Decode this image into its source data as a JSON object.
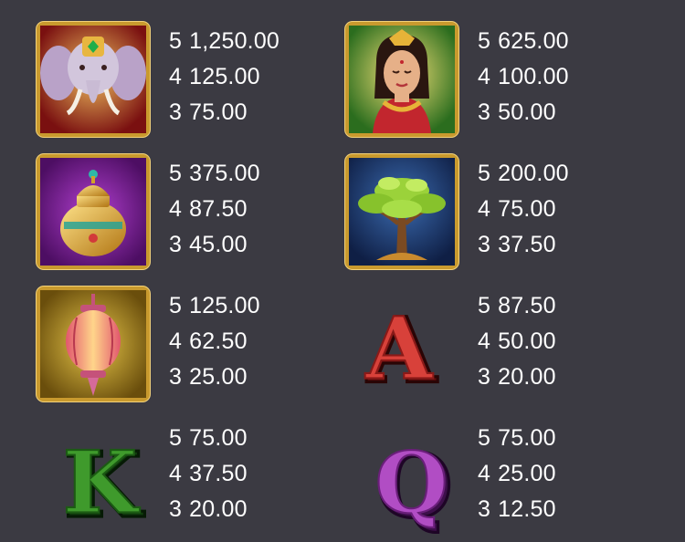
{
  "symbols": [
    {
      "icon": "elephant-icon",
      "payouts": [
        {
          "count": "5",
          "value": "1,250.00"
        },
        {
          "count": "4",
          "value": "125.00"
        },
        {
          "count": "3",
          "value": "75.00"
        }
      ]
    },
    {
      "icon": "princess-icon",
      "payouts": [
        {
          "count": "5",
          "value": "625.00"
        },
        {
          "count": "4",
          "value": "100.00"
        },
        {
          "count": "3",
          "value": "50.00"
        }
      ]
    },
    {
      "icon": "golden-pot-icon",
      "payouts": [
        {
          "count": "5",
          "value": "375.00"
        },
        {
          "count": "4",
          "value": "87.50"
        },
        {
          "count": "3",
          "value": "45.00"
        }
      ]
    },
    {
      "icon": "tree-icon",
      "payouts": [
        {
          "count": "5",
          "value": "200.00"
        },
        {
          "count": "4",
          "value": "75.00"
        },
        {
          "count": "3",
          "value": "37.50"
        }
      ]
    },
    {
      "icon": "lantern-icon",
      "payouts": [
        {
          "count": "5",
          "value": "125.00"
        },
        {
          "count": "4",
          "value": "62.50"
        },
        {
          "count": "3",
          "value": "25.00"
        }
      ]
    },
    {
      "icon": "letter-a-icon",
      "letter": "A",
      "color": "#d8413a",
      "payouts": [
        {
          "count": "5",
          "value": "87.50"
        },
        {
          "count": "4",
          "value": "50.00"
        },
        {
          "count": "3",
          "value": "20.00"
        }
      ]
    },
    {
      "icon": "letter-k-icon",
      "letter": "K",
      "color": "#3f9a2c",
      "payouts": [
        {
          "count": "5",
          "value": "75.00"
        },
        {
          "count": "4",
          "value": "37.50"
        },
        {
          "count": "3",
          "value": "20.00"
        }
      ]
    },
    {
      "icon": "letter-q-icon",
      "letter": "Q",
      "color": "#b14dc4",
      "payouts": [
        {
          "count": "5",
          "value": "75.00"
        },
        {
          "count": "4",
          "value": "25.00"
        },
        {
          "count": "3",
          "value": "12.50"
        }
      ]
    }
  ],
  "colors": {
    "background": "#3b3a42",
    "frame_gold": "#c99a2e",
    "text": "#ffffff"
  }
}
